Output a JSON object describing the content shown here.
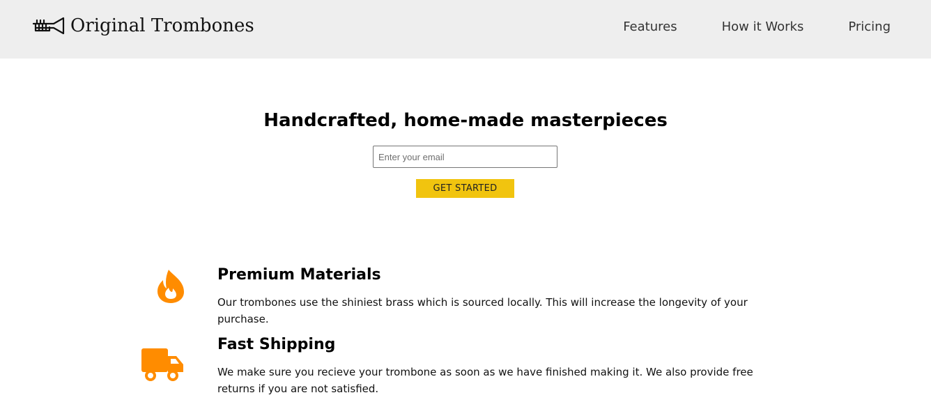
{
  "header": {
    "brand": "Original Trombones",
    "logo_icon": "trumpet-logo-icon",
    "nav": [
      {
        "label": "Features"
      },
      {
        "label": "How it Works"
      },
      {
        "label": "Pricing"
      }
    ]
  },
  "hero": {
    "title": "Handcrafted, home-made masterpieces",
    "email_placeholder": "Enter your email",
    "email_value": "",
    "cta_label": "GET STARTED"
  },
  "features": [
    {
      "icon": "flame-icon",
      "title": "Premium Materials",
      "description": "Our trombones use the shiniest brass which is sourced locally. This will increase the longevity of your purchase."
    },
    {
      "icon": "truck-icon",
      "title": "Fast Shipping",
      "description": "We make sure you recieve your trombone as soon as we have finished making it. We also provide free returns if you are not satisfied."
    }
  ],
  "colors": {
    "header_bg": "#eeeeee",
    "cta_bg": "#f1c40f",
    "icon_color": "#ff8c00"
  }
}
